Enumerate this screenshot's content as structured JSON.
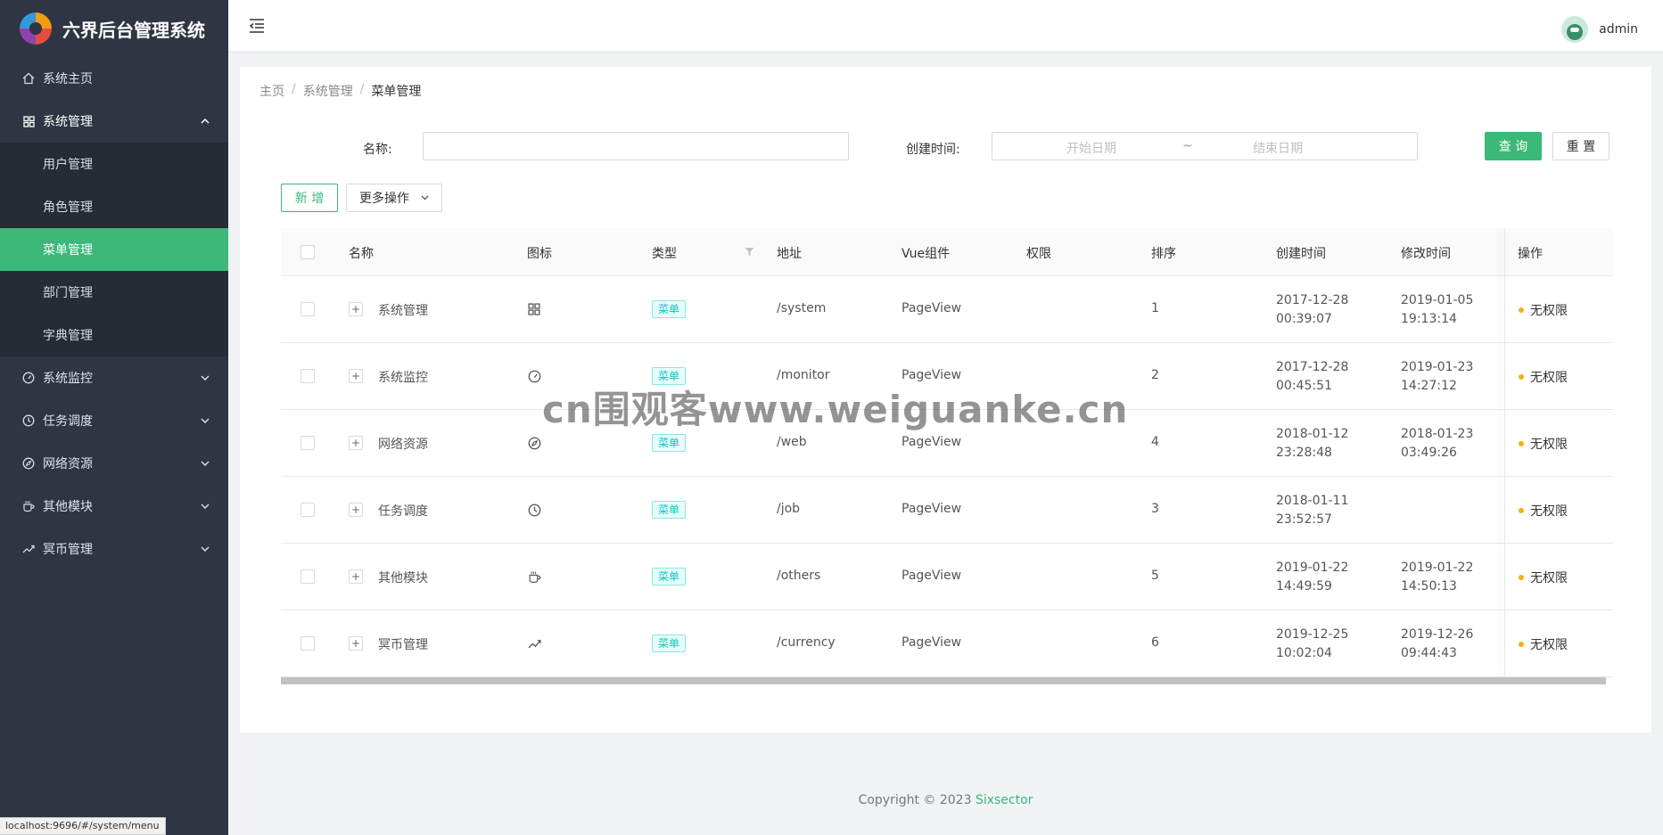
{
  "app": {
    "title": "六界后台管理系统"
  },
  "sidebar": {
    "items": [
      {
        "label": "系统主页",
        "icon": "home-icon"
      },
      {
        "label": "系统管理",
        "icon": "grid-icon",
        "open": true,
        "children": [
          {
            "label": "用户管理"
          },
          {
            "label": "角色管理"
          },
          {
            "label": "菜单管理",
            "active": true
          },
          {
            "label": "部门管理"
          },
          {
            "label": "字典管理"
          }
        ]
      },
      {
        "label": "系统监控",
        "icon": "dashboard-icon"
      },
      {
        "label": "任务调度",
        "icon": "clock-icon"
      },
      {
        "label": "网络资源",
        "icon": "compass-icon"
      },
      {
        "label": "其他模块",
        "icon": "coffee-icon"
      },
      {
        "label": "冥币管理",
        "icon": "trend-icon"
      }
    ]
  },
  "header": {
    "username": "admin"
  },
  "breadcrumb": [
    "主页",
    "系统管理",
    "菜单管理"
  ],
  "search": {
    "name_label": "名称:",
    "name_value": "",
    "created_label": "创建时间:",
    "start_placeholder": "开始日期",
    "range_sep": "~",
    "end_placeholder": "结束日期",
    "query_label": "查 询",
    "reset_label": "重 置"
  },
  "toolbar": {
    "add_label": "新 增",
    "more_label": "更多操作"
  },
  "table": {
    "columns": [
      "名称",
      "图标",
      "类型",
      "地址",
      "Vue组件",
      "权限",
      "排序",
      "创建时间",
      "修改时间",
      "操作"
    ],
    "rows": [
      {
        "name": "系统管理",
        "icon": "grid-icon",
        "type": "菜单",
        "path": "/system",
        "component": "PageView",
        "perm": "",
        "order": "1",
        "created_date": "2017-12-28",
        "created_time": "00:39:07",
        "modified_date": "2019-01-05",
        "modified_time": "19:13:14",
        "action": "无权限"
      },
      {
        "name": "系统监控",
        "icon": "dashboard-icon",
        "type": "菜单",
        "path": "/monitor",
        "component": "PageView",
        "perm": "",
        "order": "2",
        "created_date": "2017-12-28",
        "created_time": "00:45:51",
        "modified_date": "2019-01-23",
        "modified_time": "14:27:12",
        "action": "无权限"
      },
      {
        "name": "网络资源",
        "icon": "compass-icon",
        "type": "菜单",
        "path": "/web",
        "component": "PageView",
        "perm": "",
        "order": "4",
        "created_date": "2018-01-12",
        "created_time": "23:28:48",
        "modified_date": "2018-01-23",
        "modified_time": "03:49:26",
        "action": "无权限"
      },
      {
        "name": "任务调度",
        "icon": "clock-icon",
        "type": "菜单",
        "path": "/job",
        "component": "PageView",
        "perm": "",
        "order": "3",
        "created_date": "2018-01-11",
        "created_time": "23:52:57",
        "modified_date": "",
        "modified_time": "",
        "action": "无权限"
      },
      {
        "name": "其他模块",
        "icon": "coffee-icon",
        "type": "菜单",
        "path": "/others",
        "component": "PageView",
        "perm": "",
        "order": "5",
        "created_date": "2019-01-22",
        "created_time": "14:49:59",
        "modified_date": "2019-01-22",
        "modified_time": "14:50:13",
        "action": "无权限"
      },
      {
        "name": "冥币管理",
        "icon": "trend-icon",
        "type": "菜单",
        "path": "/currency",
        "component": "PageView",
        "perm": "",
        "order": "6",
        "created_date": "2019-12-25",
        "created_time": "10:02:04",
        "modified_date": "2019-12-26",
        "modified_time": "09:44:43",
        "action": "无权限"
      }
    ]
  },
  "footer": {
    "copyright": "Copyright © 2023 ",
    "link": "Sixsector"
  },
  "statusbar": {
    "url": "localhost:9696/#/system/menu"
  },
  "watermark": "cn围观客www.weiguanke.cn",
  "colors": {
    "primary": "#3cb878",
    "sidebar_bg": "#2f3542",
    "tag": "#13c2c2",
    "warning_dot": "#faad14"
  }
}
